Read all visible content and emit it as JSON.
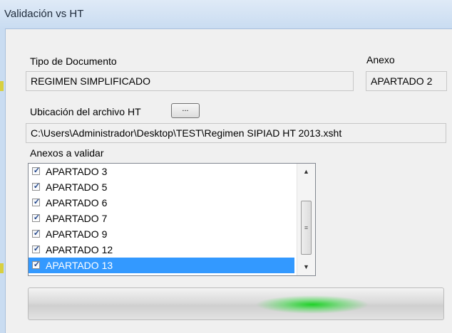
{
  "window": {
    "title": "Validación vs HT"
  },
  "tipo_documento": {
    "label": "Tipo de Documento",
    "value": "REGIMEN  SIMPLIFICADO"
  },
  "anexo": {
    "label": "Anexo",
    "value": "APARTADO 2"
  },
  "archivo": {
    "label": "Ubicación del archivo HT",
    "browse_label": "...",
    "path": "C:\\Users\\Administrador\\Desktop\\TEST\\Regimen SIPIAD HT 2013.xsht"
  },
  "anexos_validar": {
    "label": "Anexos a validar",
    "items": [
      {
        "label": "APARTADO 3",
        "checked": true,
        "selected": false
      },
      {
        "label": "APARTADO 5",
        "checked": true,
        "selected": false
      },
      {
        "label": "APARTADO 6",
        "checked": true,
        "selected": false
      },
      {
        "label": "APARTADO 7",
        "checked": true,
        "selected": false
      },
      {
        "label": "APARTADO 9",
        "checked": true,
        "selected": false
      },
      {
        "label": "APARTADO 12",
        "checked": true,
        "selected": false
      },
      {
        "label": "APARTADO 13",
        "checked": true,
        "selected": true
      }
    ]
  },
  "progress": {
    "state": "indeterminate"
  },
  "colors": {
    "selection": "#3399ff",
    "progress_glow": "#14d21e",
    "titlebar": "#c9dcf1"
  },
  "icons": {
    "check": "checkmark-icon",
    "scroll_up": "scroll-up-icon",
    "scroll_down": "scroll-down-icon"
  }
}
